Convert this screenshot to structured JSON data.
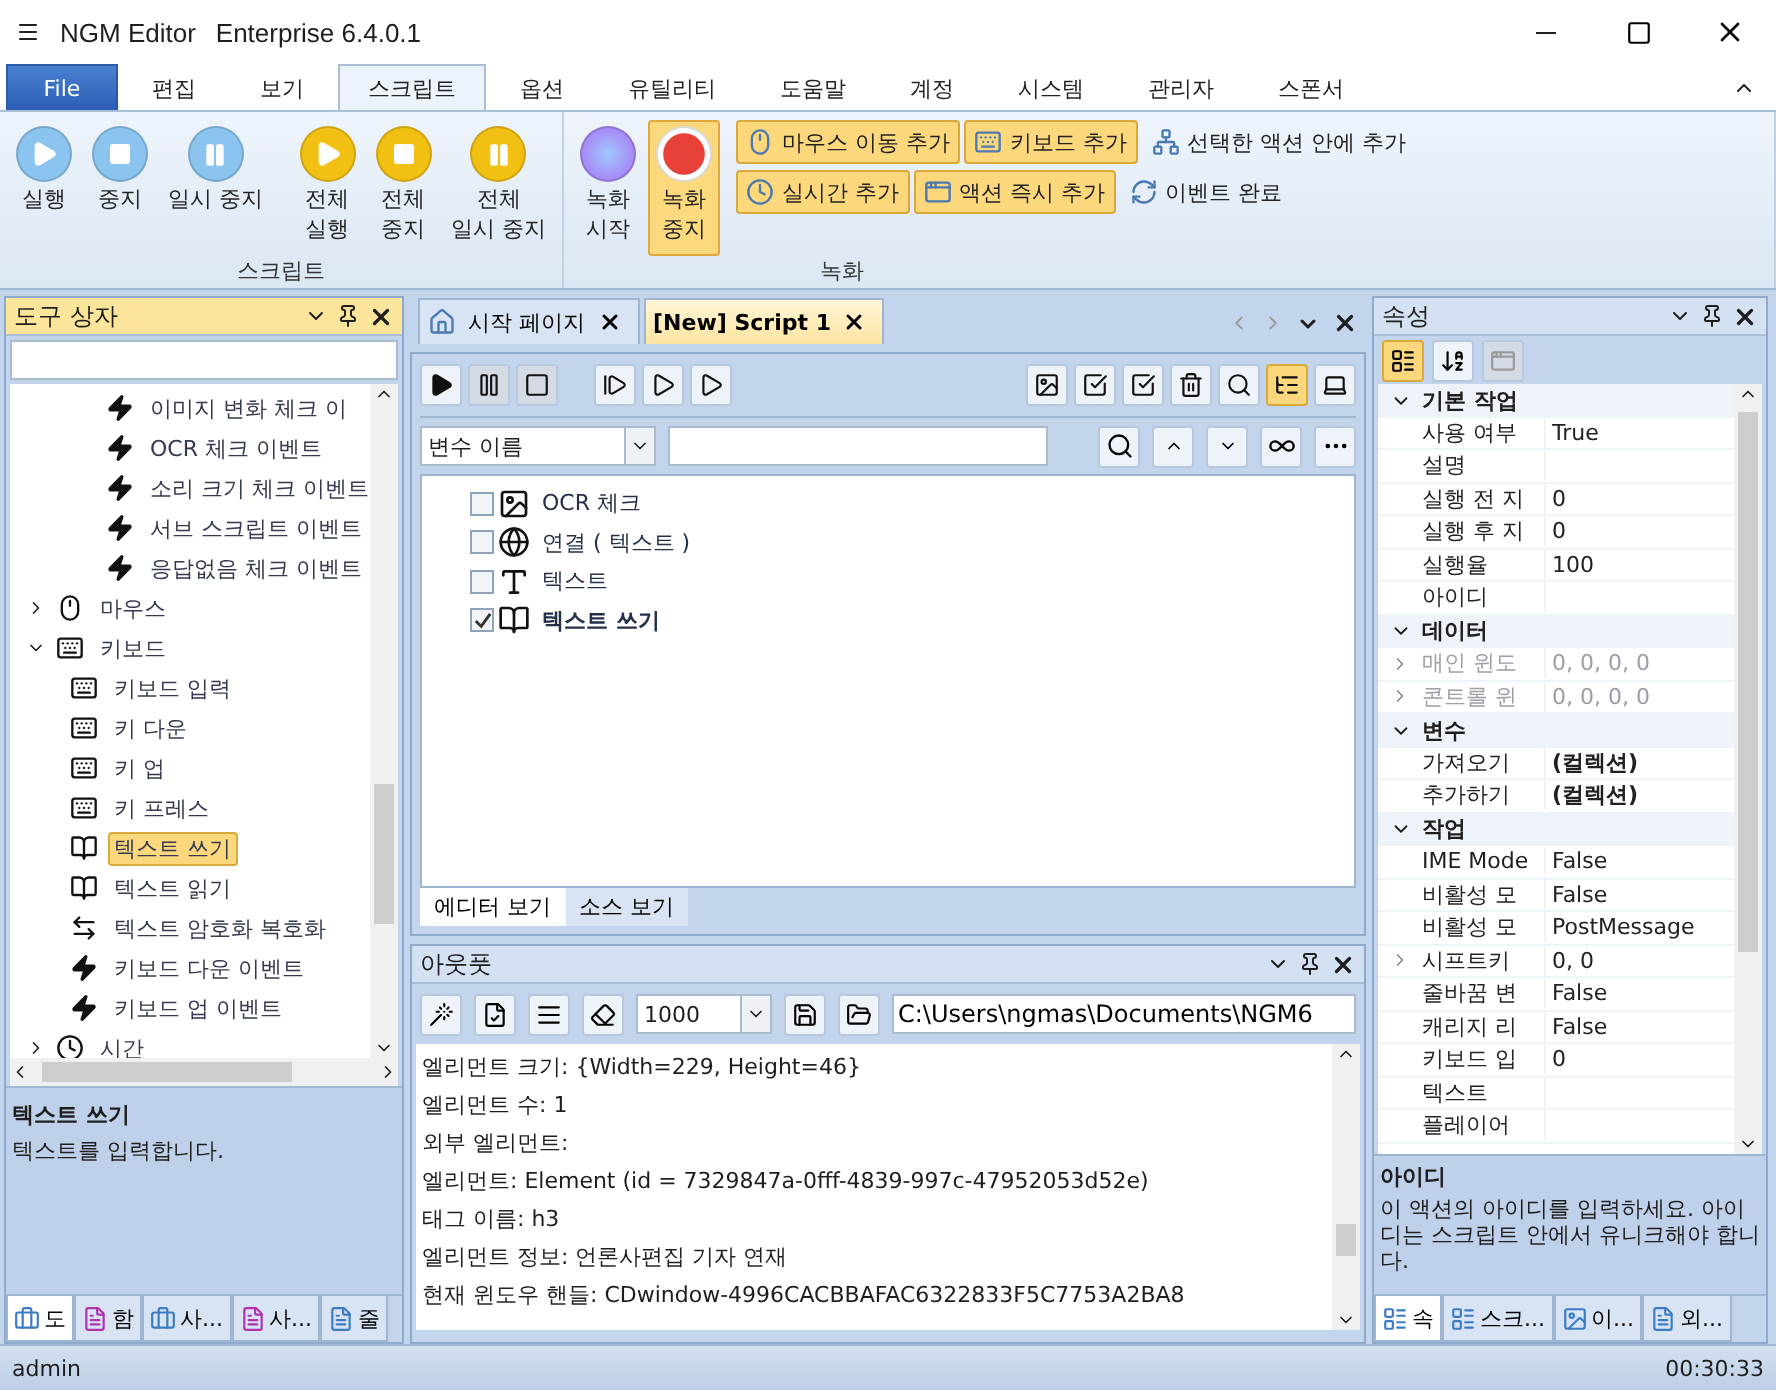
{
  "window": {
    "title": "NGM Editor",
    "edition": "Enterprise 6.4.0.1"
  },
  "menu_tabs": [
    {
      "label": "File",
      "kind": "file",
      "selected": false
    },
    {
      "label": "편집",
      "kind": "tab",
      "selected": false
    },
    {
      "label": "보기",
      "kind": "tab",
      "selected": false
    },
    {
      "label": "스크립트",
      "kind": "tab",
      "selected": true
    },
    {
      "label": "옵션",
      "kind": "tab",
      "selected": false
    },
    {
      "label": "유틸리티",
      "kind": "tab",
      "selected": false
    },
    {
      "label": "도움말",
      "kind": "tab",
      "selected": false
    },
    {
      "label": "계정",
      "kind": "tab",
      "selected": false
    },
    {
      "label": "시스템",
      "kind": "tab",
      "selected": false
    },
    {
      "label": "관리자",
      "kind": "tab",
      "selected": false
    },
    {
      "label": "스폰서",
      "kind": "tab",
      "selected": false
    }
  ],
  "ribbon": {
    "script_group": {
      "title": "스크립트",
      "buttons": [
        {
          "lines": [
            "실행"
          ],
          "kind": "play",
          "color": "#8cc4f0"
        },
        {
          "lines": [
            "중지"
          ],
          "kind": "stop",
          "color": "#8cc4f0"
        },
        {
          "lines": [
            "일시 중지"
          ],
          "kind": "pause",
          "color": "#8cc4f0"
        },
        {
          "lines": [
            "전체",
            "실행"
          ],
          "kind": "play",
          "color": "#f2c012"
        },
        {
          "lines": [
            "전체",
            "중지"
          ],
          "kind": "stop",
          "color": "#f2c012"
        },
        {
          "lines": [
            "전체",
            "일시 중지"
          ],
          "kind": "pause",
          "color": "#f2c012"
        }
      ]
    },
    "record_group": {
      "title": "녹화",
      "buttons": [
        {
          "lines": [
            "녹화",
            "시작"
          ],
          "kind": "record-start",
          "active": false
        },
        {
          "lines": [
            "녹화",
            "중지"
          ],
          "kind": "record-stop",
          "active": true
        }
      ],
      "small_rows": [
        [
          {
            "label": "마우스 이동 추가",
            "kind": "mouse",
            "active": true
          },
          {
            "label": "키보드 추가",
            "kind": "keyboard",
            "active": true
          },
          {
            "label": "선택한 액션 안에 추가",
            "kind": "tree",
            "active": false
          }
        ],
        [
          {
            "label": "실시간 추가",
            "kind": "clock",
            "active": true
          },
          {
            "label": "액션 즉시 추가",
            "kind": "window",
            "active": true
          },
          {
            "label": "이벤트 완료",
            "kind": "refresh",
            "active": false
          }
        ]
      ]
    }
  },
  "toolbox": {
    "title": "도구 상자",
    "tree": [
      {
        "children": [
          {
            "label": "이미지 변화 체크 이",
            "kind": "event",
            "selected": false
          },
          {
            "label": "OCR 체크 이벤트",
            "kind": "event",
            "selected": false
          },
          {
            "label": "소리 크기 체크 이벤트",
            "kind": "event",
            "selected": false
          },
          {
            "label": "서브 스크립트 이벤트",
            "kind": "event",
            "selected": false
          },
          {
            "label": "응답없음 체크 이벤트",
            "kind": "event",
            "selected": false
          }
        ]
      },
      {
        "label": "마우스",
        "kind": "mouse",
        "expanded": false,
        "selected": false
      },
      {
        "label": "키보드",
        "kind": "keyboard",
        "expanded": true,
        "selected": false,
        "children": [
          {
            "label": "키보드 입력",
            "kind": "keyboard",
            "selected": false
          },
          {
            "label": "키 다운",
            "kind": "key-down",
            "selected": false
          },
          {
            "label": "키 업",
            "kind": "key-up",
            "selected": false
          },
          {
            "label": "키 프레스",
            "kind": "key-press",
            "selected": false
          },
          {
            "label": "텍스트 쓰기",
            "kind": "book",
            "selected": true
          },
          {
            "label": "텍스트 읽기",
            "kind": "book",
            "selected": false
          },
          {
            "label": "텍스트 암호화 복호화",
            "kind": "swap",
            "selected": false
          },
          {
            "label": "키보드 다운 이벤트",
            "kind": "event",
            "selected": false
          },
          {
            "label": "키보드 업 이벤트",
            "kind": "event",
            "selected": false
          }
        ]
      },
      {
        "label": "시간",
        "kind": "clock",
        "expanded": false,
        "selected": false
      }
    ],
    "description": {
      "title": "텍스트 쓰기",
      "text": "텍스트를 입력합니다."
    },
    "tabs": [
      {
        "label": "도",
        "kind": "toolbox",
        "selected": true
      },
      {
        "label": "함",
        "kind": "fx",
        "selected": false
      },
      {
        "label": "사...",
        "kind": "toolbox",
        "selected": false
      },
      {
        "label": "사...",
        "kind": "fx",
        "selected": false
      },
      {
        "label": "줄",
        "kind": "doc",
        "selected": false
      }
    ]
  },
  "documents": {
    "tabs": [
      {
        "label": "시작 페이지",
        "kind": "home",
        "selected": false
      },
      {
        "label": "[New] Script 1",
        "kind": "script",
        "selected": true
      }
    ]
  },
  "editor": {
    "toolbar": [
      {
        "kind": "play",
        "disabled": false,
        "active": false
      },
      {
        "kind": "pause",
        "disabled": true,
        "active": false
      },
      {
        "kind": "stop",
        "disabled": true,
        "active": false
      },
      {
        "kind": "step",
        "disabled": false,
        "active": false
      },
      {
        "kind": "run-box",
        "disabled": false,
        "active": false
      },
      {
        "kind": "play-box",
        "disabled": false,
        "active": false
      },
      {
        "kind": "image",
        "disabled": false,
        "active": false
      },
      {
        "kind": "check-filled",
        "disabled": false,
        "active": false
      },
      {
        "kind": "check",
        "disabled": false,
        "active": false
      },
      {
        "kind": "delete",
        "disabled": false,
        "active": false
      },
      {
        "kind": "zoom",
        "disabled": false,
        "active": false
      },
      {
        "kind": "tree",
        "disabled": false,
        "active": true
      },
      {
        "kind": "laptop",
        "disabled": false,
        "active": false
      }
    ],
    "variable_select": "변수 이름",
    "actions": [
      {
        "label": "OCR 체크",
        "kind": "image",
        "checked": false,
        "selected": false
      },
      {
        "label": "연결 ( 텍스트 )",
        "kind": "globe",
        "checked": false,
        "selected": false
      },
      {
        "label": "텍스트",
        "kind": "text",
        "checked": false,
        "selected": false
      },
      {
        "label": "텍스트 쓰기",
        "kind": "book",
        "checked": true,
        "selected": true
      }
    ],
    "view_tabs": [
      {
        "label": "에디터 보기",
        "selected": true
      },
      {
        "label": "소스 보기",
        "selected": false
      }
    ]
  },
  "output": {
    "title": "아웃풋",
    "limit": "1000",
    "path": "C:\\Users\\ngmas\\Documents\\NGM6",
    "lines": [
      "엘리먼트 크기: {Width=229, Height=46}",
      "엘리먼트 수: 1",
      "외부 엘리먼트:",
      "엘리먼트: Element (id = 7329847a-0fff-4839-997c-47952053d52e)",
      "태그 이름: h3",
      "엘리먼트 정보: 언론사편집 기자 연재",
      "현재 윈도우 핸들: CDwindow-4996CACBBAFAC6322833F5C7753A2BA8"
    ]
  },
  "properties": {
    "title": "속성",
    "categories": [
      {
        "name": "기본 작업",
        "expanded": true,
        "rows": [
          {
            "name": "사용 여부",
            "value": "True",
            "kind": "plain"
          },
          {
            "name": "설명",
            "kind": "plain"
          },
          {
            "name": "실행 전 지",
            "value": "0",
            "kind": "plain"
          },
          {
            "name": "실행 후 지",
            "value": "0",
            "kind": "plain"
          },
          {
            "name": "실행율",
            "value": "100",
            "kind": "plain"
          },
          {
            "name": "아이디",
            "kind": "plain"
          }
        ]
      },
      {
        "name": "데이터",
        "expanded": true,
        "rows": [
          {
            "name": "매인 윈도",
            "value": "0, 0, 0, 0",
            "kind": "nested-disabled"
          },
          {
            "name": "콘트롤 윈",
            "value": "0, 0, 0, 0",
            "kind": "nested-disabled"
          }
        ]
      },
      {
        "name": "변수",
        "expanded": true,
        "rows": [
          {
            "name": "가져오기",
            "value": "(컬렉션)",
            "kind": "collection"
          },
          {
            "name": "추가하기",
            "value": "(컬렉션)",
            "kind": "collection"
          }
        ]
      },
      {
        "name": "작업",
        "expanded": true,
        "rows": [
          {
            "name": "IME Mode",
            "value": "False",
            "kind": "plain"
          },
          {
            "name": "비활성 모",
            "value": "False",
            "kind": "plain"
          },
          {
            "name": "비활성 모",
            "value": "PostMessage",
            "kind": "plain"
          },
          {
            "name": "시프트키",
            "value": "0, 0",
            "kind": "nested"
          },
          {
            "name": "줄바꿈 변",
            "value": "False",
            "kind": "plain"
          },
          {
            "name": "캐리지 리",
            "value": "False",
            "kind": "plain"
          },
          {
            "name": "키보드 입",
            "value": "0",
            "kind": "plain"
          },
          {
            "name": "텍스트",
            "kind": "plain"
          },
          {
            "name": "플레이어",
            "kind": "plain"
          }
        ]
      }
    ],
    "help": {
      "title": "아이디",
      "text": "이 액션의 아이디를 입력하세요. 아이디는 스크립트 안에서 유니크해야 합니다."
    },
    "tabs": [
      {
        "label": "속",
        "kind": "props",
        "selected": true
      },
      {
        "label": "스크...",
        "kind": "props",
        "selected": false
      },
      {
        "label": "이...",
        "kind": "image",
        "selected": false
      },
      {
        "label": "외...",
        "kind": "api",
        "selected": false
      }
    ]
  },
  "status_bar": {
    "user": "admin",
    "time": "00:30:33"
  }
}
